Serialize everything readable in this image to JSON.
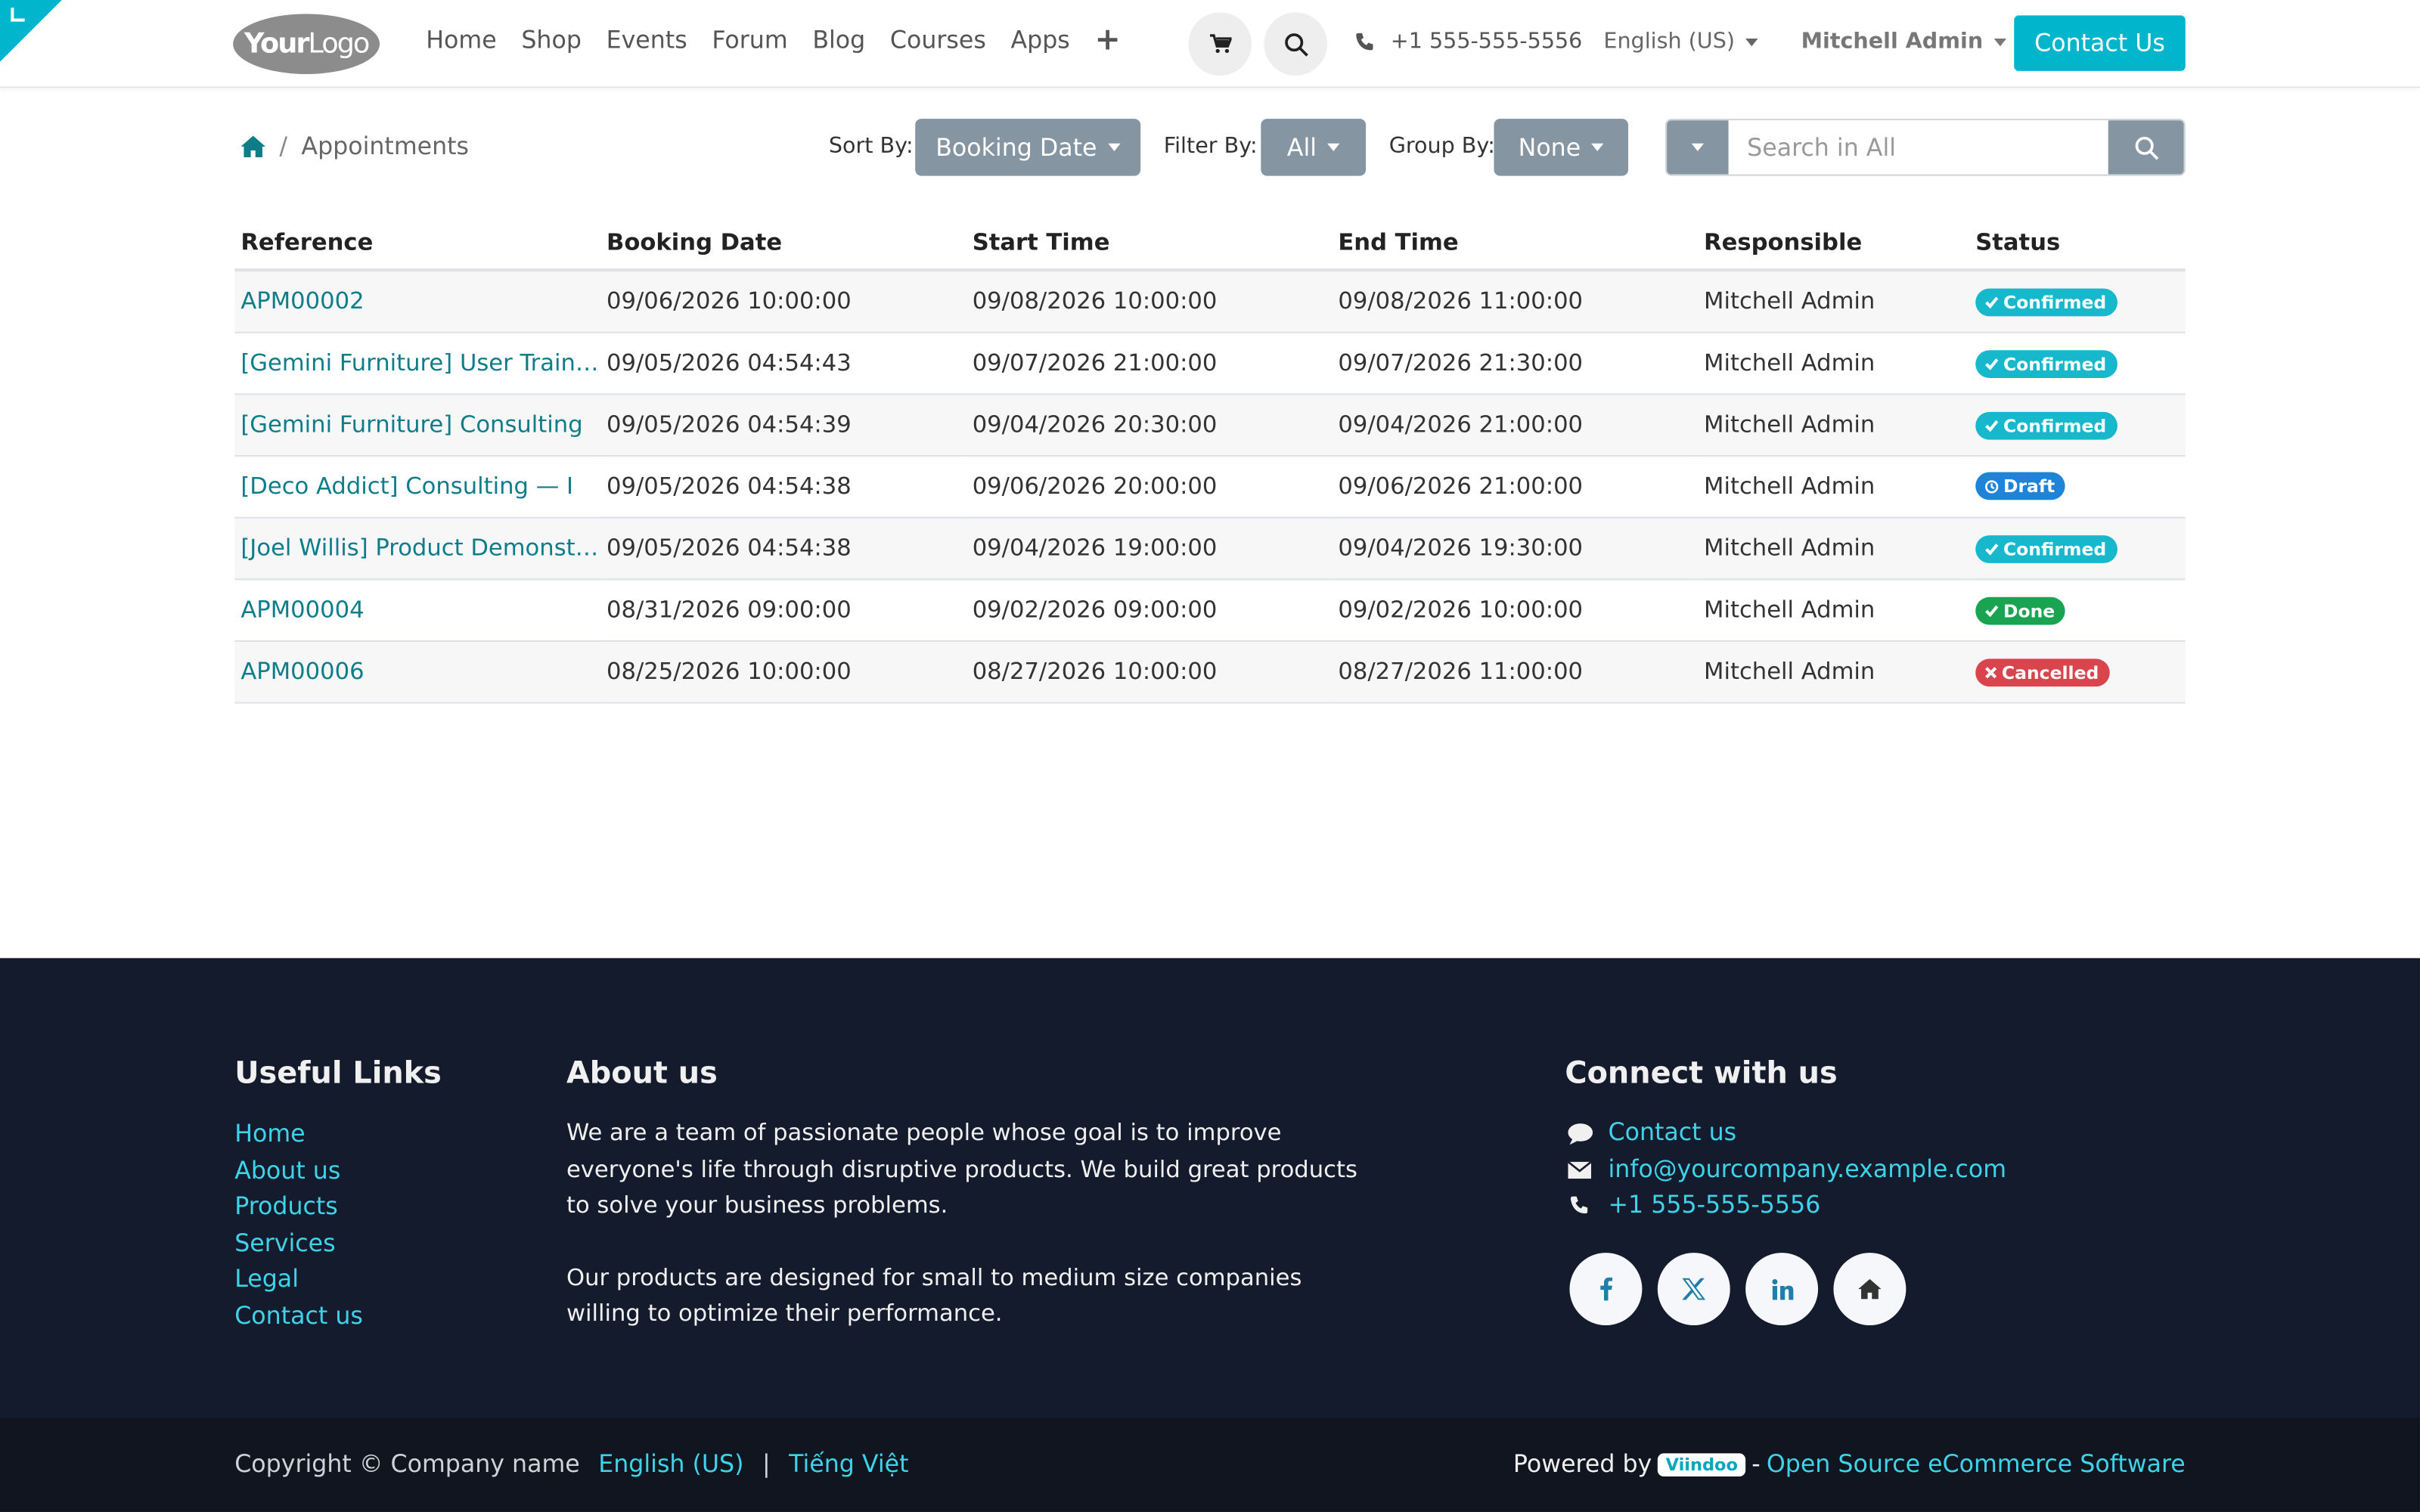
{
  "header": {
    "logo_part1": "Your",
    "logo_part2": "Logo",
    "nav": [
      "Home",
      "Shop",
      "Events",
      "Forum",
      "Blog",
      "Courses",
      "Apps"
    ],
    "phone": "+1 555-555-5556",
    "language": "English (US)",
    "user": "Mitchell Admin",
    "contact_button": "Contact Us"
  },
  "toolbar": {
    "breadcrumb_current": "Appointments",
    "sort_label": "Sort By:",
    "sort_value": "Booking Date",
    "filter_label": "Filter By:",
    "filter_value": "All",
    "group_label": "Group By:",
    "group_value": "None",
    "search_placeholder": "Search in All"
  },
  "table": {
    "columns": [
      "Reference",
      "Booking Date",
      "Start Time",
      "End Time",
      "Responsible",
      "Status"
    ],
    "rows": [
      {
        "ref": "APM00002",
        "booking": "09/06/2026 10:00:00",
        "start": "09/08/2026 10:00:00",
        "end": "09/08/2026 11:00:00",
        "responsible": "Mitchell Admin",
        "status": "Confirmed",
        "status_class": "b-confirmed"
      },
      {
        "ref": "[Gemini Furniture] User Training",
        "booking": "09/05/2026 04:54:43",
        "start": "09/07/2026 21:00:00",
        "end": "09/07/2026 21:30:00",
        "responsible": "Mitchell Admin",
        "status": "Confirmed",
        "status_class": "b-confirmed"
      },
      {
        "ref": "[Gemini Furniture] Consulting",
        "booking": "09/05/2026 04:54:39",
        "start": "09/04/2026 20:30:00",
        "end": "09/04/2026 21:00:00",
        "responsible": "Mitchell Admin",
        "status": "Confirmed",
        "status_class": "b-confirmed"
      },
      {
        "ref": "[Deco Addict] Consulting — I",
        "booking": "09/05/2026 04:54:38",
        "start": "09/06/2026 20:00:00",
        "end": "09/06/2026 21:00:00",
        "responsible": "Mitchell Admin",
        "status": "Draft",
        "status_class": "b-draft"
      },
      {
        "ref": "[Joel Willis] Product Demonstration",
        "booking": "09/05/2026 04:54:38",
        "start": "09/04/2026 19:00:00",
        "end": "09/04/2026 19:30:00",
        "responsible": "Mitchell Admin",
        "status": "Confirmed",
        "status_class": "b-confirmed"
      },
      {
        "ref": "APM00004",
        "booking": "08/31/2026 09:00:00",
        "start": "09/02/2026 09:00:00",
        "end": "09/02/2026 10:00:00",
        "responsible": "Mitchell Admin",
        "status": "Done",
        "status_class": "b-done"
      },
      {
        "ref": "APM00006",
        "booking": "08/25/2026 10:00:00",
        "start": "08/27/2026 10:00:00",
        "end": "08/27/2026 11:00:00",
        "responsible": "Mitchell Admin",
        "status": "Cancelled",
        "status_class": "b-cancelled"
      }
    ]
  },
  "footer": {
    "useful_title": "Useful Links",
    "useful_links": [
      "Home",
      "About us",
      "Products",
      "Services",
      "Legal",
      "Contact us"
    ],
    "about_title": "About us",
    "about_p1": "We are a team of passionate people whose goal is to improve everyone's life through disruptive products. We build great products to solve your business problems.",
    "about_p2": "Our products are designed for small to medium size companies willing to optimize their performance.",
    "connect_title": "Connect with us",
    "connect_contact": "Contact us",
    "connect_email": "info@yourcompany.example.com",
    "connect_phone": "+1 555-555-5556",
    "copyright": "Copyright © Company name",
    "lang_en": "English (US)",
    "lang_sep": "|",
    "lang_vi": "Tiếng Việt",
    "powered_by": "Powered by",
    "viindoo": "Viindoo",
    "dash": "-",
    "powered_link": "Open Source eCommerce Software"
  },
  "colors": {
    "accent": "#00b5cc",
    "footer_bg": "#141b2d",
    "dropdown_bg": "#8595a2",
    "link": "#0d7d8a"
  }
}
